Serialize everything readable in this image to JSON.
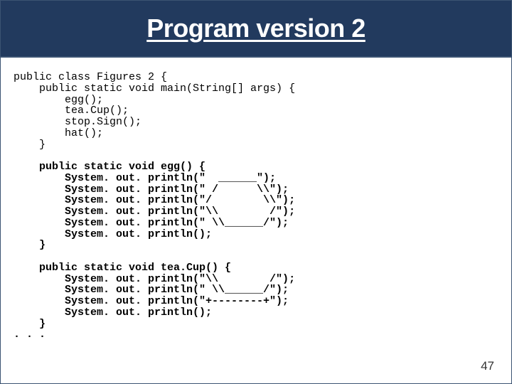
{
  "title": "Program version 2",
  "page_number": "47",
  "code": {
    "l01": "public class Figures 2 {",
    "l02": "    public static void main(String[] args) {",
    "l03": "        egg();",
    "l04": "        tea.Cup();",
    "l05": "        stop.Sign();",
    "l06": "        hat();",
    "l07": "    }",
    "l08": "",
    "l09": "    public static void egg() {",
    "l10": "        System. out. println(\"  ______\");",
    "l11": "        System. out. println(\" /      \\\\\");",
    "l12": "        System. out. println(\"/        \\\\\");",
    "l13": "        System. out. println(\"\\\\        /\");",
    "l14": "        System. out. println(\" \\\\______/\");",
    "l15": "        System. out. println();",
    "l16": "    }",
    "l17": "",
    "l18": "    public static void tea.Cup() {",
    "l19": "        System. out. println(\"\\\\        /\");",
    "l20": "        System. out. println(\" \\\\______/\");",
    "l21": "        System. out. println(\"+--------+\");",
    "l22": "        System. out. println();",
    "l23": "    }",
    "l24": ". . ."
  }
}
